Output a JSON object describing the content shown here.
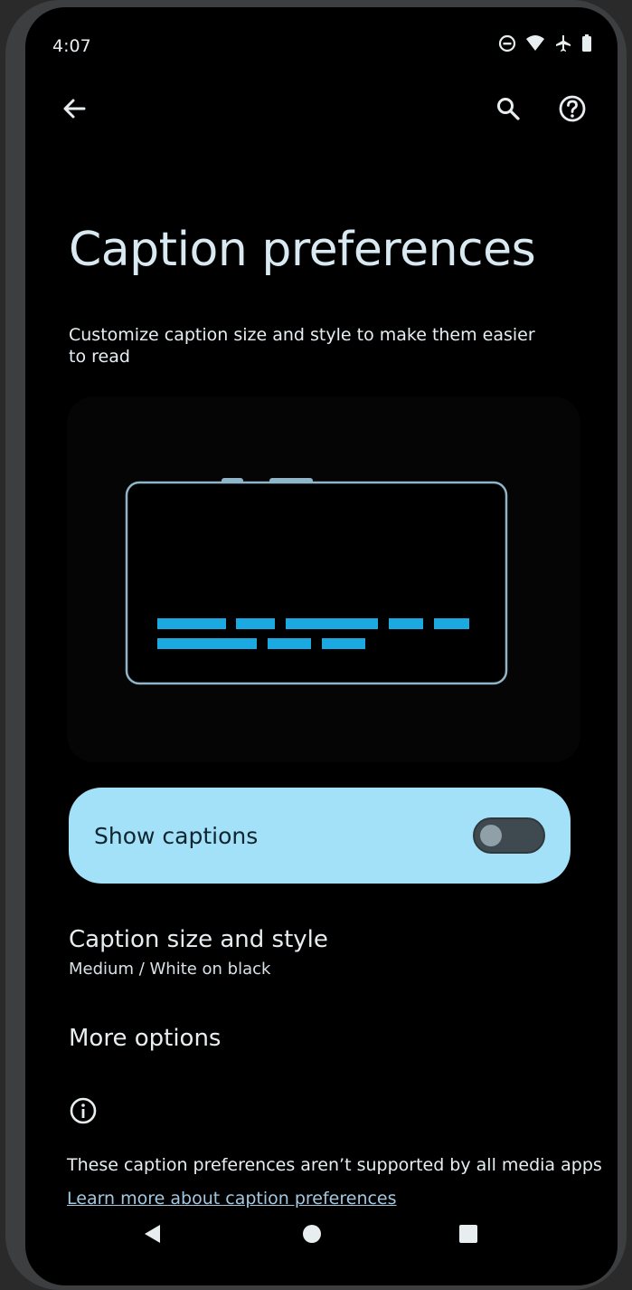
{
  "status_bar": {
    "time": "4:07",
    "icons": [
      "do-not-disturb-icon",
      "wifi-icon",
      "airplane-icon",
      "battery-icon"
    ]
  },
  "toolbar": {
    "back_icon": "arrow-left-icon",
    "search_icon": "search-icon",
    "help_icon": "help-icon"
  },
  "page": {
    "title": "Caption preferences",
    "subtitle": "Customize caption size and style to make them easier to read"
  },
  "preview": {
    "accent_color": "#1ba9e2",
    "frame_color": "#8fb6c8"
  },
  "show_captions": {
    "label": "Show captions",
    "enabled": false,
    "background": "#a3e1f8"
  },
  "caption_size": {
    "title": "Caption size and style",
    "summary": "Medium / White on black"
  },
  "more_options": {
    "title": "More options"
  },
  "footer": {
    "info_icon": "info-icon",
    "note": "These caption preferences aren’t supported by all media apps",
    "link": "Learn more about caption preferences"
  },
  "nav_bar": {
    "back": "triangle-back-icon",
    "home": "circle-home-icon",
    "recents": "square-recents-icon"
  }
}
